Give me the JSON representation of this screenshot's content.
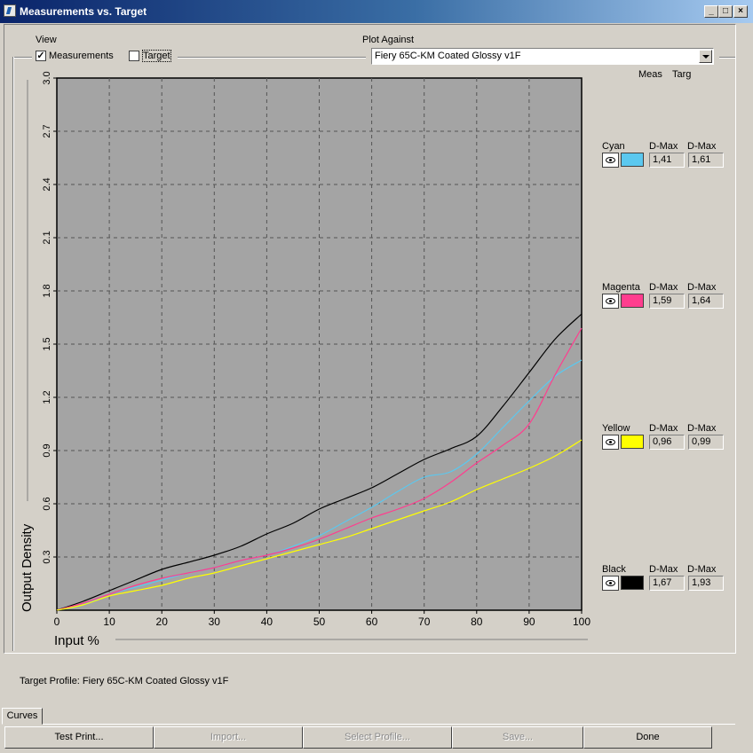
{
  "window": {
    "title": "Measurements vs. Target"
  },
  "view": {
    "label": "View",
    "measurements_label": "Measurements",
    "measurements_checked": true,
    "target_label": "Target",
    "target_checked": false
  },
  "plot_against": {
    "label": "Plot Against",
    "selected": "Fiery 65C-KM Coated Glossy v1F"
  },
  "columns": {
    "meas": "Meas",
    "targ": "Targ"
  },
  "chart_data": {
    "type": "line",
    "xlabel": "Input %",
    "ylabel": "Output Density",
    "xlim": [
      0,
      100
    ],
    "ylim": [
      0,
      3.0
    ],
    "xticks": [
      "0",
      "10",
      "20",
      "30",
      "40",
      "50",
      "60",
      "70",
      "80",
      "90",
      "100"
    ],
    "yticks": [
      "0.3",
      "0.6",
      "0.9",
      "1.2",
      "1.5",
      "1.8",
      "2.1",
      "2.4",
      "2.7",
      "3.0"
    ],
    "grid": true,
    "series": [
      {
        "name": "Black",
        "color": "#000000",
        "x": [
          0,
          5,
          10,
          15,
          20,
          25,
          30,
          35,
          40,
          45,
          50,
          55,
          60,
          65,
          70,
          75,
          80,
          85,
          90,
          95,
          100
        ],
        "y": [
          0,
          0.05,
          0.11,
          0.17,
          0.23,
          0.27,
          0.31,
          0.36,
          0.43,
          0.49,
          0.57,
          0.63,
          0.69,
          0.77,
          0.85,
          0.91,
          0.98,
          1.15,
          1.34,
          1.53,
          1.67
        ]
      },
      {
        "name": "Cyan",
        "color": "#5bc8ef",
        "x": [
          0,
          5,
          10,
          15,
          20,
          25,
          30,
          35,
          40,
          45,
          50,
          55,
          60,
          65,
          70,
          75,
          80,
          85,
          90,
          95,
          100
        ],
        "y": [
          0,
          0.03,
          0.09,
          0.13,
          0.17,
          0.21,
          0.24,
          0.28,
          0.31,
          0.36,
          0.42,
          0.5,
          0.58,
          0.67,
          0.75,
          0.78,
          0.88,
          1.03,
          1.18,
          1.32,
          1.41
        ]
      },
      {
        "name": "Magenta",
        "color": "#ff3d8e",
        "x": [
          0,
          5,
          10,
          15,
          20,
          25,
          30,
          35,
          40,
          45,
          50,
          55,
          60,
          65,
          70,
          75,
          80,
          85,
          90,
          95,
          100
        ],
        "y": [
          0,
          0.04,
          0.09,
          0.14,
          0.18,
          0.21,
          0.24,
          0.28,
          0.31,
          0.35,
          0.4,
          0.46,
          0.52,
          0.57,
          0.63,
          0.72,
          0.83,
          0.93,
          1.05,
          1.33,
          1.59
        ]
      },
      {
        "name": "Yellow",
        "color": "#ffff00",
        "x": [
          0,
          5,
          10,
          15,
          20,
          25,
          30,
          35,
          40,
          45,
          50,
          55,
          60,
          65,
          70,
          75,
          80,
          85,
          90,
          95,
          100
        ],
        "y": [
          0,
          0.03,
          0.08,
          0.11,
          0.14,
          0.18,
          0.21,
          0.25,
          0.29,
          0.33,
          0.37,
          0.41,
          0.46,
          0.51,
          0.56,
          0.61,
          0.68,
          0.74,
          0.8,
          0.87,
          0.96
        ]
      }
    ]
  },
  "channels": [
    {
      "name": "Cyan",
      "dmax_label": "D-Max",
      "meas": "1,41",
      "targ": "1,61",
      "color": "#5bc8ef"
    },
    {
      "name": "Magenta",
      "dmax_label": "D-Max",
      "meas": "1,59",
      "targ": "1,64",
      "color": "#ff3d8e"
    },
    {
      "name": "Yellow",
      "dmax_label": "D-Max",
      "meas": "0,96",
      "targ": "0,99",
      "color": "#ffff00"
    },
    {
      "name": "Black",
      "dmax_label": "D-Max",
      "meas": "1,67",
      "targ": "1,93",
      "color": "#000000"
    }
  ],
  "target_profile": "Target Profile: Fiery 65C-KM Coated Glossy v1F",
  "tab": {
    "label": "Curves"
  },
  "buttons": {
    "test_print": "Test Print...",
    "import": "Import...",
    "select_profile": "Select Profile...",
    "save": "Save...",
    "done": "Done"
  }
}
